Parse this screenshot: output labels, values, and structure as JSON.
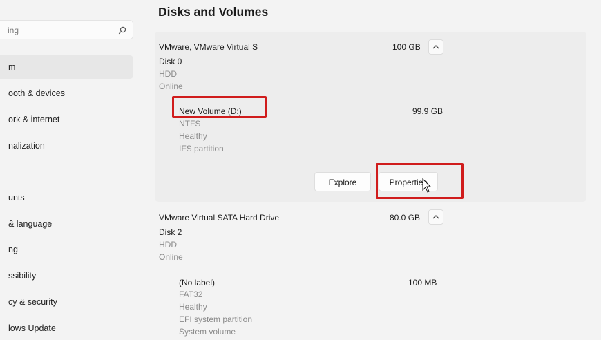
{
  "sidebar": {
    "search_text": "ing",
    "items": [
      {
        "label": "m",
        "active": true
      },
      {
        "label": "ooth & devices",
        "active": false
      },
      {
        "label": "ork & internet",
        "active": false
      },
      {
        "label": "nalization",
        "active": false
      },
      {
        "label": "unts",
        "active": false
      },
      {
        "label": "& language",
        "active": false
      },
      {
        "label": "ng",
        "active": false
      },
      {
        "label": "ssibility",
        "active": false
      },
      {
        "label": "cy & security",
        "active": false
      },
      {
        "label": "lows Update",
        "active": false
      }
    ]
  },
  "page": {
    "title": "Disks and Volumes"
  },
  "disks": [
    {
      "name": "VMware, VMware Virtual S",
      "size": "100 GB",
      "disk_label": "Disk 0",
      "type": "HDD",
      "status": "Online",
      "volume": {
        "name": "New Volume (D:)",
        "size": "99.9 GB",
        "filesystem": "NTFS",
        "health": "Healthy",
        "partition": "IFS partition",
        "explore_label": "Explore",
        "properties_label": "Properties"
      }
    },
    {
      "name": "VMware Virtual SATA Hard Drive",
      "size": "80.0 GB",
      "disk_label": "Disk 2",
      "type": "HDD",
      "status": "Online",
      "volume": {
        "name": "(No label)",
        "size": "100 MB",
        "filesystem": "FAT32",
        "health": "Healthy",
        "partition": "EFI system partition",
        "extra": "System volume"
      }
    }
  ],
  "colors": {
    "highlight": "#d01c1c",
    "background": "#f3f3f3",
    "card": "#ededed"
  }
}
